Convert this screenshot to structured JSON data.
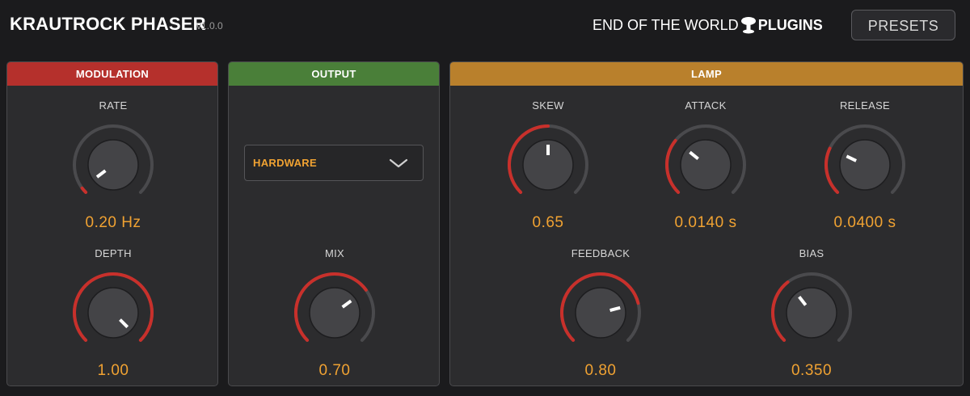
{
  "header": {
    "title": "KRAUTROCK PHASER",
    "version": "v1.0.0",
    "brand_left": "END OF THE WORLD",
    "brand_icon": "mushroom-cloud-icon",
    "brand_right": "PLUGINS",
    "presets_label": "PRESETS"
  },
  "colors": {
    "modulation_header": "#b5302c",
    "output_header": "#4a7f39",
    "lamp_header": "#b9802c",
    "arc_active": "#c8302b",
    "arc_track": "#4a4a4d",
    "value_text": "#f0a232"
  },
  "panels": {
    "modulation": {
      "title": "MODULATION",
      "knobs": [
        {
          "label": "RATE",
          "value": "0.20 Hz",
          "level": 0.03
        },
        {
          "label": "DEPTH",
          "value": "1.00",
          "level": 1.0
        }
      ]
    },
    "output": {
      "title": "OUTPUT",
      "dropdown_value": "HARDWARE",
      "knobs": [
        {
          "label": "MIX",
          "value": "0.70",
          "level": 0.7
        }
      ]
    },
    "lamp": {
      "title": "LAMP",
      "knobs": [
        {
          "label": "SKEW",
          "value": "0.65",
          "level": 0.5
        },
        {
          "label": "ATTACK",
          "value": "0.0140 s",
          "level": 0.31
        },
        {
          "label": "RELEASE",
          "value": "0.0400 s",
          "level": 0.26
        },
        {
          "label": "FEEDBACK",
          "value": "0.80",
          "level": 0.78
        },
        {
          "label": "BIAS",
          "value": "0.350",
          "level": 0.36
        }
      ]
    }
  }
}
